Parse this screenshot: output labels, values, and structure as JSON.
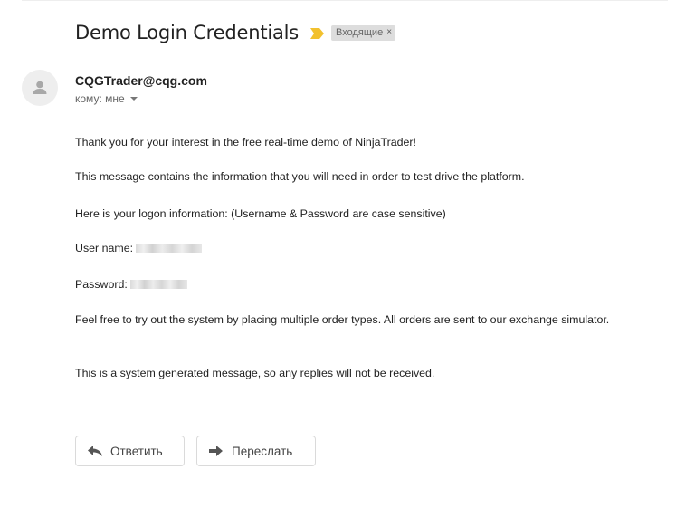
{
  "email": {
    "subject": "Demo Login Credentials",
    "label": "Входящие",
    "label_close": "×",
    "importance_color": "#f2c12e",
    "sender": "CQGTrader@cqg.com",
    "recipient": "кому: мне"
  },
  "body": {
    "line1": "Thank you for your interest in the free real-time demo of NinjaTrader!",
    "line2": "This message contains the information that you will need in order to test drive the platform.",
    "line3": "Here is your logon information:  (Username & Password are case sensitive)",
    "username_label": "User name:",
    "password_label": "Password:",
    "line4": "Feel free to try out the system by placing multiple order types.  All orders are sent to our exchange simulator.",
    "line5": "This is a system generated message, so any replies will not be received."
  },
  "actions": {
    "reply_label": "Ответить",
    "forward_label": "Переслать"
  },
  "icons": {
    "avatar": "person-icon",
    "reply": "reply-icon",
    "forward": "forward-icon",
    "importance": "importance-marker-icon"
  }
}
